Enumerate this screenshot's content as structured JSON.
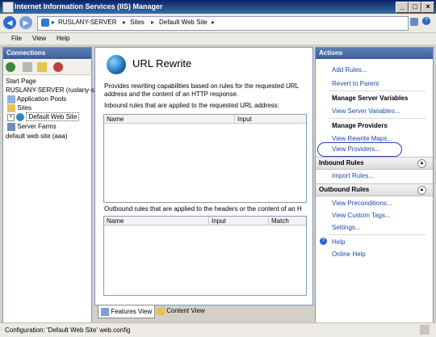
{
  "window": {
    "title": "Internet Information Services (IIS) Manager"
  },
  "address": {
    "crumbs": [
      "RUSLANY-SERVER",
      "Sites",
      "Default Web Site"
    ]
  },
  "menu": [
    "File",
    "View",
    "Help"
  ],
  "connections": {
    "header": "Connections",
    "tree": [
      "Start Page",
      "RUSLANY-SERVER (ruslany-se",
      "Application Pools",
      "Sites",
      "Default Web Site",
      "Server Farms",
      "default web site (aaa)"
    ]
  },
  "main": {
    "title": "URL Rewrite",
    "description": "Provides rewriting capabilities based on rules for the requested URL address and the content of an HTTP response.",
    "inbound_label": "Inbound rules that are applied to the requested URL address:",
    "inbound_columns": [
      "Name",
      "Input"
    ],
    "outbound_label": "Outbound rules that are applied to the headers or the content of an H",
    "outbound_columns": [
      "Name",
      "Input",
      "Match"
    ]
  },
  "view_tabs": [
    "Features View",
    "Content View"
  ],
  "actions": {
    "header": "Actions",
    "add_rules": "Add Rules...",
    "revert": "Revert to Parent",
    "manage_vars_head": "Manage Server Variables",
    "view_vars": "View Server Variables...",
    "manage_providers_head": "Manage Providers",
    "view_maps": "View Rewrite Maps...",
    "view_providers": "View Providers...",
    "inbound_group": "Inbound Rules",
    "import_rules": "Import Rules...",
    "outbound_group": "Outbound Rules",
    "view_preconditions": "View Preconditions...",
    "view_custom_tags": "View Custom Tags...",
    "settings": "Settings...",
    "help": "Help",
    "online_help": "Online Help"
  },
  "status": {
    "text": "Configuration: 'Default Web Site' web.config"
  },
  "colors": {
    "title_bar": "#0a246a",
    "link": "#1a4ba8",
    "highlight_ring": "#2c3fb0"
  }
}
